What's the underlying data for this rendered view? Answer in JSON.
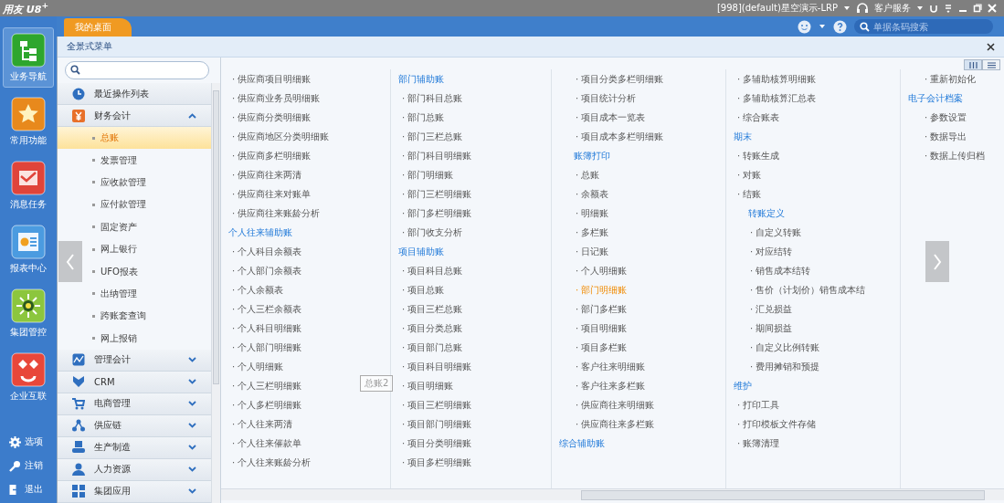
{
  "title_bar": {
    "logo": "用友 U8$^{+}$",
    "account": "[998](default)星空演示-LRP",
    "service": "客户服务"
  },
  "tabs": [
    {
      "label": "我的桌面",
      "selected": true
    }
  ],
  "search": {
    "placeholder": "单据条码搜索"
  },
  "nav": [
    {
      "label": "业务导航",
      "kind": "sitemap",
      "color": "#2ea62e",
      "selected": true
    },
    {
      "label": "常用功能",
      "kind": "star",
      "color": "#e8891c",
      "selected": false
    },
    {
      "label": "消息任务",
      "kind": "mail",
      "color": "#e0443a",
      "selected": false
    },
    {
      "label": "报表中心",
      "kind": "report",
      "color": "#4b9be0",
      "selected": false
    },
    {
      "label": "集团管控",
      "kind": "sun",
      "color": "#8cc63e",
      "selected": false
    },
    {
      "label": "企业互联",
      "kind": "diamond",
      "color": "#e8473a",
      "selected": false
    }
  ],
  "bottom_actions": [
    {
      "label": "选项",
      "kind": "gear"
    },
    {
      "label": "注销",
      "kind": "key"
    },
    {
      "label": "退出",
      "kind": "exit"
    }
  ],
  "panel": {
    "title": "全景式菜单"
  },
  "modules": [
    {
      "label": "最近操作列表",
      "kind": "clock",
      "expanded": false
    },
    {
      "label": "财务会计",
      "kind": "yen",
      "expanded": true,
      "children": [
        {
          "label": "总账",
          "selected": true
        },
        {
          "label": "发票管理",
          "selected": false
        },
        {
          "label": "应收款管理",
          "selected": false
        },
        {
          "label": "应付款管理",
          "selected": false
        },
        {
          "label": "固定资产",
          "selected": false
        },
        {
          "label": "网上银行",
          "selected": false
        },
        {
          "label": "UFO报表",
          "selected": false
        },
        {
          "label": "出纳管理",
          "selected": false
        },
        {
          "label": "跨账套查询",
          "selected": false
        },
        {
          "label": "网上报销",
          "selected": false
        }
      ]
    },
    {
      "label": "管理会计",
      "kind": "chart",
      "expanded": false
    },
    {
      "label": "CRM",
      "kind": "crm",
      "expanded": false
    },
    {
      "label": "电商管理",
      "kind": "cart",
      "expanded": false
    },
    {
      "label": "供应链",
      "kind": "network",
      "expanded": false
    },
    {
      "label": "生产制造",
      "kind": "machine",
      "expanded": false
    },
    {
      "label": "人力资源",
      "kind": "person",
      "expanded": false
    },
    {
      "label": "集团应用",
      "kind": "grid",
      "expanded": false
    }
  ],
  "view_toggle": [
    {
      "kind": "columns",
      "selected": true
    },
    {
      "kind": "list",
      "selected": false
    }
  ],
  "menu_columns": [
    [
      {
        "kind": "item",
        "label": "· 供应商项目明细账",
        "selected": false
      },
      {
        "kind": "item",
        "label": "· 供应商业务员明细账",
        "selected": false
      },
      {
        "kind": "item",
        "label": "· 供应商分类明细账",
        "selected": false
      },
      {
        "kind": "item",
        "label": "· 供应商地区分类明细账",
        "selected": false
      },
      {
        "kind": "item",
        "label": "· 供应商多栏明细账",
        "selected": false
      },
      {
        "kind": "item",
        "label": "· 供应商往来两清",
        "selected": false
      },
      {
        "kind": "item",
        "label": "· 供应商往来对账单",
        "selected": false
      },
      {
        "kind": "item",
        "label": "· 供应商往来账龄分析",
        "selected": false
      },
      {
        "kind": "heading",
        "label": "个人往来辅助账",
        "selected": false
      },
      {
        "kind": "item",
        "label": "· 个人科目余额表",
        "selected": false
      },
      {
        "kind": "item",
        "label": "· 个人部门余额表",
        "selected": false
      },
      {
        "kind": "item",
        "label": "· 个人余额表",
        "selected": false
      },
      {
        "kind": "item",
        "label": "· 个人三栏余额表",
        "selected": false
      },
      {
        "kind": "item",
        "label": "· 个人科目明细账",
        "selected": false
      },
      {
        "kind": "item",
        "label": "· 个人部门明细账",
        "selected": false
      },
      {
        "kind": "item",
        "label": "· 个人明细账",
        "selected": false
      },
      {
        "kind": "item",
        "label": "· 个人三栏明细账",
        "selected": false
      },
      {
        "kind": "item",
        "label": "· 个人多栏明细账",
        "selected": false
      },
      {
        "kind": "item",
        "label": "· 个人往来两清",
        "selected": false
      },
      {
        "kind": "item",
        "label": "· 个人往来催款单",
        "selected": false
      },
      {
        "kind": "item",
        "label": "· 个人往来账龄分析",
        "selected": false
      }
    ],
    [
      {
        "kind": "heading",
        "label": "部门辅助账",
        "selected": false
      },
      {
        "kind": "item",
        "label": "· 部门科目总账",
        "selected": false
      },
      {
        "kind": "item",
        "label": "· 部门总账",
        "selected": false
      },
      {
        "kind": "item",
        "label": "· 部门三栏总账",
        "selected": false
      },
      {
        "kind": "item",
        "label": "· 部门科目明细账",
        "selected": false
      },
      {
        "kind": "item",
        "label": "· 部门明细账",
        "selected": false
      },
      {
        "kind": "item",
        "label": "· 部门三栏明细账",
        "selected": false
      },
      {
        "kind": "item",
        "label": "· 部门多栏明细账",
        "selected": false
      },
      {
        "kind": "item",
        "label": "· 部门收支分析",
        "selected": false
      },
      {
        "kind": "heading",
        "label": "项目辅助账",
        "selected": false
      },
      {
        "kind": "item",
        "label": "· 项目科目总账",
        "selected": false
      },
      {
        "kind": "item",
        "label": "· 项目总账",
        "selected": false
      },
      {
        "kind": "item",
        "label": "· 项目三栏总账",
        "selected": false
      },
      {
        "kind": "item",
        "label": "· 项目分类总账",
        "selected": false
      },
      {
        "kind": "item",
        "label": "· 项目部门总账",
        "selected": false
      },
      {
        "kind": "item",
        "label": "· 项目科目明细账",
        "selected": false
      },
      {
        "kind": "item",
        "label": "· 项目明细账",
        "selected": false
      },
      {
        "kind": "item",
        "label": "· 项目三栏明细账",
        "selected": false
      },
      {
        "kind": "item",
        "label": "· 项目部门明细账",
        "selected": false
      },
      {
        "kind": "item",
        "label": "· 项目分类明细账",
        "selected": false
      },
      {
        "kind": "item",
        "label": "· 项目多栏明细账",
        "selected": false
      }
    ],
    [
      {
        "kind": "subitem",
        "label": "· 项目分类多栏明细账",
        "selected": false
      },
      {
        "kind": "subitem",
        "label": "· 项目统计分析",
        "selected": false
      },
      {
        "kind": "subitem",
        "label": "· 项目成本一览表",
        "selected": false
      },
      {
        "kind": "subitem",
        "label": "· 项目成本多栏明细账",
        "selected": false
      },
      {
        "kind": "subheading",
        "label": "账簿打印",
        "selected": false
      },
      {
        "kind": "subitem",
        "label": "· 总账",
        "selected": false
      },
      {
        "kind": "subitem",
        "label": "· 余额表",
        "selected": false
      },
      {
        "kind": "subitem",
        "label": "· 明细账",
        "selected": false
      },
      {
        "kind": "subitem",
        "label": "· 多栏账",
        "selected": false
      },
      {
        "kind": "subitem",
        "label": "· 日记账",
        "selected": false
      },
      {
        "kind": "subitem",
        "label": "· 个人明细账",
        "selected": false
      },
      {
        "kind": "subitem",
        "label": "· 部门明细账",
        "selected": true
      },
      {
        "kind": "subitem",
        "label": "· 部门多栏账",
        "selected": false
      },
      {
        "kind": "subitem",
        "label": "· 项目明细账",
        "selected": false
      },
      {
        "kind": "subitem",
        "label": "· 项目多栏账",
        "selected": false
      },
      {
        "kind": "subitem",
        "label": "· 客户往来明细账",
        "selected": false
      },
      {
        "kind": "subitem",
        "label": "· 客户往来多栏账",
        "selected": false
      },
      {
        "kind": "subitem",
        "label": "· 供应商往来明细账",
        "selected": false
      },
      {
        "kind": "subitem",
        "label": "· 供应商往来多栏账",
        "selected": false
      },
      {
        "kind": "heading",
        "label": "综合辅助账",
        "selected": false
      }
    ],
    [
      {
        "kind": "item",
        "label": "· 多辅助核算明细账",
        "selected": false
      },
      {
        "kind": "item",
        "label": "· 多辅助核算汇总表",
        "selected": false
      },
      {
        "kind": "item",
        "label": "· 综合账表",
        "selected": false
      },
      {
        "kind": "heading",
        "label": "期末",
        "selected": false
      },
      {
        "kind": "item",
        "label": "· 转账生成",
        "selected": false
      },
      {
        "kind": "item",
        "label": "· 对账",
        "selected": false
      },
      {
        "kind": "item",
        "label": "· 结账",
        "selected": false
      },
      {
        "kind": "subheading",
        "label": "转账定义",
        "selected": false
      },
      {
        "kind": "subitem",
        "label": "· 自定义转账",
        "selected": false
      },
      {
        "kind": "subitem",
        "label": "· 对应结转",
        "selected": false
      },
      {
        "kind": "subitem",
        "label": "· 销售成本结转",
        "selected": false
      },
      {
        "kind": "subitem",
        "label": "· 售价（计划价）销售成本结",
        "selected": false
      },
      {
        "kind": "subitem",
        "label": "· 汇兑损益",
        "selected": false
      },
      {
        "kind": "subitem",
        "label": "· 期间损益",
        "selected": false
      },
      {
        "kind": "subitem",
        "label": "· 自定义比例转账",
        "selected": false
      },
      {
        "kind": "subitem",
        "label": "· 费用摊销和预提",
        "selected": false
      },
      {
        "kind": "heading",
        "label": "维护",
        "selected": false
      },
      {
        "kind": "item",
        "label": "· 打印工具",
        "selected": false
      },
      {
        "kind": "item",
        "label": "· 打印模板文件存储",
        "selected": false
      },
      {
        "kind": "item",
        "label": "· 账簿清理",
        "selected": false
      }
    ],
    [
      {
        "kind": "subitem",
        "label": "· 重新初始化",
        "selected": false
      },
      {
        "kind": "heading",
        "label": "电子会计档案",
        "selected": false
      },
      {
        "kind": "subitem",
        "label": "· 参数设置",
        "selected": false
      },
      {
        "kind": "subitem",
        "label": "· 数据导出",
        "selected": false
      },
      {
        "kind": "subitem",
        "label": "· 数据上传归档",
        "selected": false
      }
    ]
  ],
  "tooltip": "总账2"
}
